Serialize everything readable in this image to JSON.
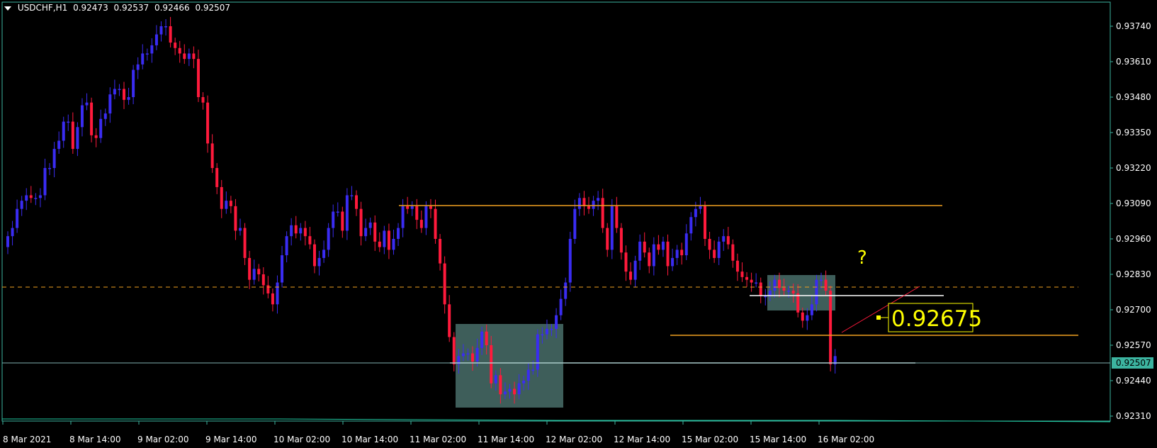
{
  "header": {
    "symbol": "USDCHF,H1",
    "open": "0.92473",
    "high": "0.92537",
    "low": "0.92466",
    "close": "0.92507"
  },
  "colors": {
    "background": "#000000",
    "frame": "#3cb4a0",
    "bull": "#3a2cf2",
    "bear": "#ff1a3c",
    "level": "#f0a020",
    "zone": "#3e5e5a",
    "label": "#ffff00",
    "bid_line": "#7fb0b0"
  },
  "price_axis": {
    "ticks": [
      "0.93740",
      "0.93610",
      "0.93480",
      "0.93350",
      "0.93220",
      "0.93090",
      "0.92960",
      "0.92830",
      "0.92700",
      "0.92570",
      "0.92440",
      "0.92310"
    ],
    "current_price": "0.92507"
  },
  "time_axis": {
    "labels": [
      "8 Mar 2021",
      "8 Mar 14:00",
      "9 Mar 02:00",
      "9 Mar 14:00",
      "10 Mar 02:00",
      "10 Mar 14:00",
      "11 Mar 02:00",
      "11 Mar 14:00",
      "12 Mar 02:00",
      "12 Mar 14:00",
      "15 Mar 02:00",
      "15 Mar 14:00",
      "16 Mar 02:00"
    ]
  },
  "annotations": {
    "price_label": "0.92675",
    "question_mark": "?"
  },
  "chart_data": {
    "type": "candlestick",
    "symbol": "USDCHF",
    "timeframe": "H1",
    "ylim": [
      0.9228,
      0.9381
    ],
    "levels": [
      0.93093,
      0.92815,
      0.92603
    ],
    "current_price": 0.92507,
    "closes": [
      0.9297,
      0.93,
      0.9307,
      0.931,
      0.9312,
      0.9311,
      0.9311,
      0.9312,
      0.9322,
      0.9322,
      0.9329,
      0.9332,
      0.9339,
      0.9339,
      0.9329,
      0.9337,
      0.9345,
      0.9346,
      0.9334,
      0.9333,
      0.934,
      0.9342,
      0.9349,
      0.9351,
      0.9351,
      0.9347,
      0.9348,
      0.9358,
      0.936,
      0.9364,
      0.9364,
      0.9367,
      0.9371,
      0.9374,
      0.9374,
      0.9368,
      0.9366,
      0.9364,
      0.9362,
      0.9364,
      0.9362,
      0.9348,
      0.9346,
      0.9331,
      0.9322,
      0.9315,
      0.9307,
      0.931,
      0.9308,
      0.9299,
      0.93,
      0.9289,
      0.9281,
      0.9285,
      0.9283,
      0.9279,
      0.9276,
      0.9272,
      0.928,
      0.929,
      0.9297,
      0.9301,
      0.9298,
      0.93,
      0.9297,
      0.9294,
      0.9286,
      0.9289,
      0.9292,
      0.93,
      0.9306,
      0.9306,
      0.9299,
      0.9312,
      0.9312,
      0.9307,
      0.9297,
      0.93,
      0.9302,
      0.9295,
      0.9293,
      0.9299,
      0.9292,
      0.9296,
      0.93,
      0.9308,
      0.9307,
      0.9308,
      0.9303,
      0.93,
      0.9308,
      0.9307,
      0.9296,
      0.9287,
      0.9272,
      0.926,
      0.925,
      0.9253,
      0.9254,
      0.9254,
      0.9251,
      0.9256,
      0.9262,
      0.9257,
      0.9243,
      0.9246,
      0.9239,
      0.924,
      0.9241,
      0.9239,
      0.9243,
      0.9244,
      0.9248,
      0.9248,
      0.9261,
      0.9261,
      0.9263,
      0.9263,
      0.9268,
      0.9274,
      0.928,
      0.9296,
      0.9307,
      0.9311,
      0.9308,
      0.9307,
      0.931,
      0.9311,
      0.93,
      0.9292,
      0.9308,
      0.93,
      0.9291,
      0.9284,
      0.9281,
      0.9288,
      0.9295,
      0.9291,
      0.9286,
      0.9294,
      0.9292,
      0.9295,
      0.9286,
      0.9289,
      0.9292,
      0.929,
      0.9298,
      0.9304,
      0.9307,
      0.9308,
      0.9296,
      0.9292,
      0.9289,
      0.9295,
      0.9297,
      0.9294,
      0.9288,
      0.9284,
      0.9282,
      0.9281,
      0.928,
      0.928,
      0.9275,
      0.9275,
      0.9277,
      0.9281,
      0.9278,
      0.9277,
      0.9277,
      0.9276,
      0.9269,
      0.9266,
      0.9268,
      0.9272,
      0.9281,
      0.9281,
      0.9277,
      0.925,
      0.9253
    ]
  }
}
